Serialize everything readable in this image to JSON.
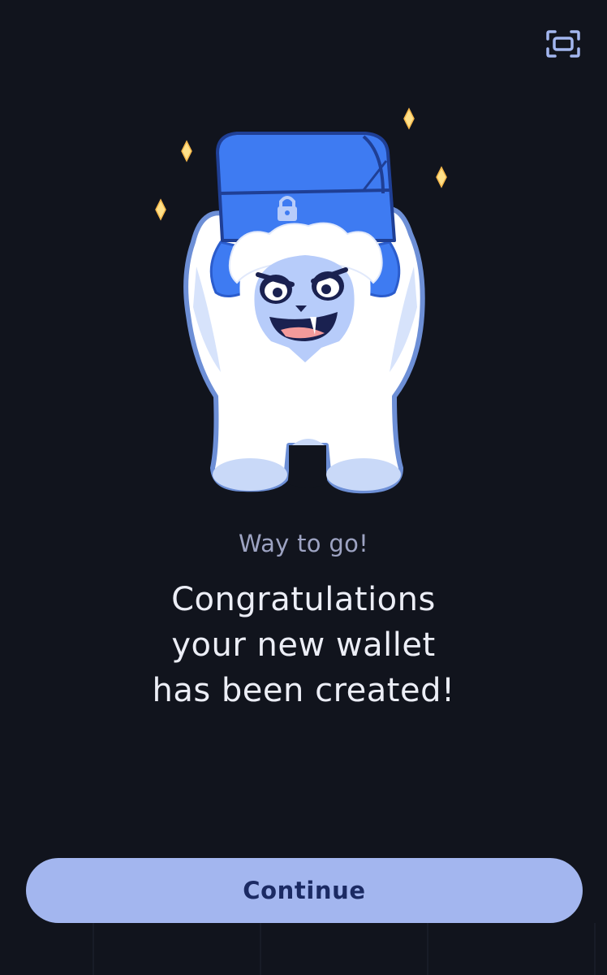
{
  "header": {
    "expand_icon": "fullscreen-frame-icon"
  },
  "illustration": {
    "subject": "yeti-holding-locked-chest",
    "accent_color": "#3e7bf2",
    "sparkle_color": "#ffe18a"
  },
  "message": {
    "subtitle": "Way to go!",
    "headline_lines": [
      "Congratulations",
      "your new wallet",
      "has been created!"
    ]
  },
  "actions": {
    "continue_label": "Continue"
  },
  "colors": {
    "background": "#11141d",
    "button_bg": "#a3b6ef",
    "button_text": "#1b2a63",
    "subtitle_text": "#9da3c2",
    "headline_text": "#eceef6"
  }
}
